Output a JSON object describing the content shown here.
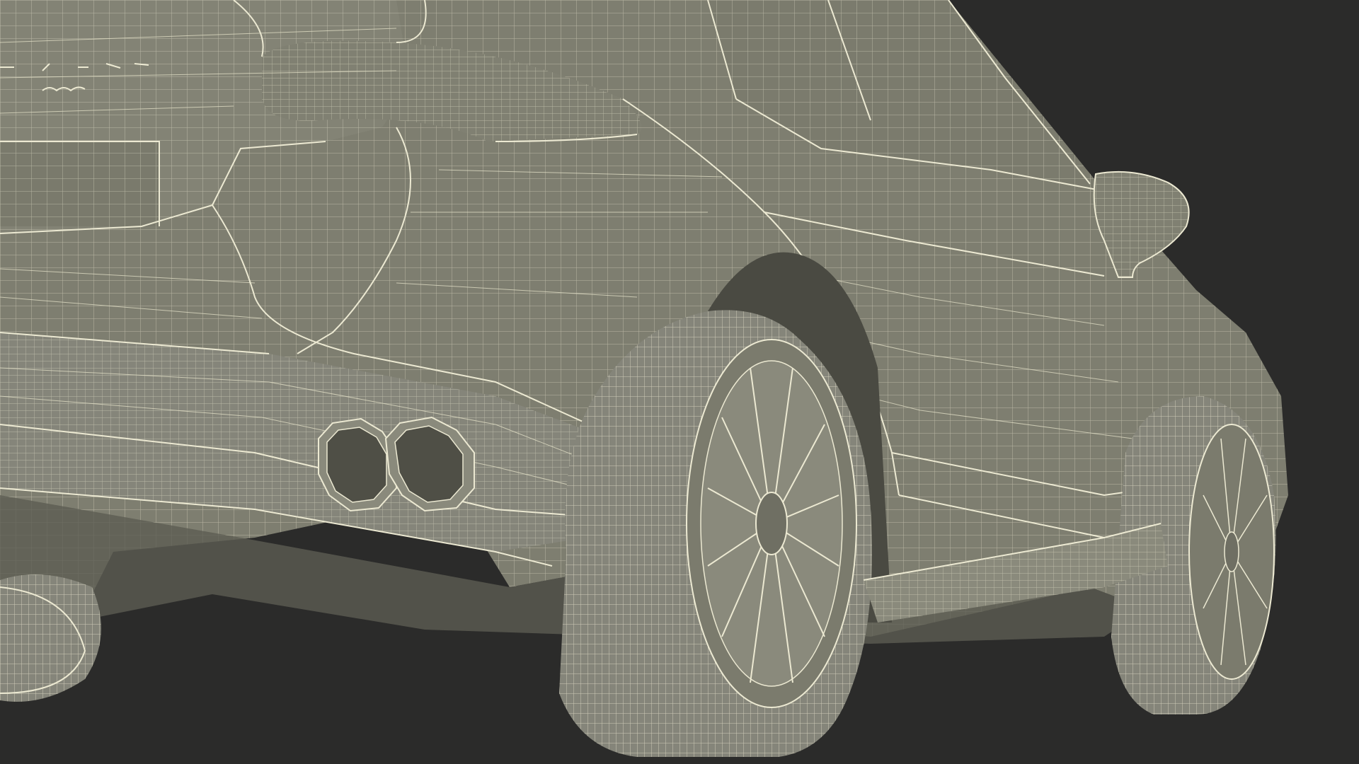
{
  "scene": {
    "subject": "car-wireframe-render",
    "colors": {
      "background": "#2b2b2a",
      "body_fill": "#7d7d6f",
      "shadow_fill": "#5f5f54",
      "wire": "#ece9d2",
      "tire": "#85857a"
    }
  }
}
